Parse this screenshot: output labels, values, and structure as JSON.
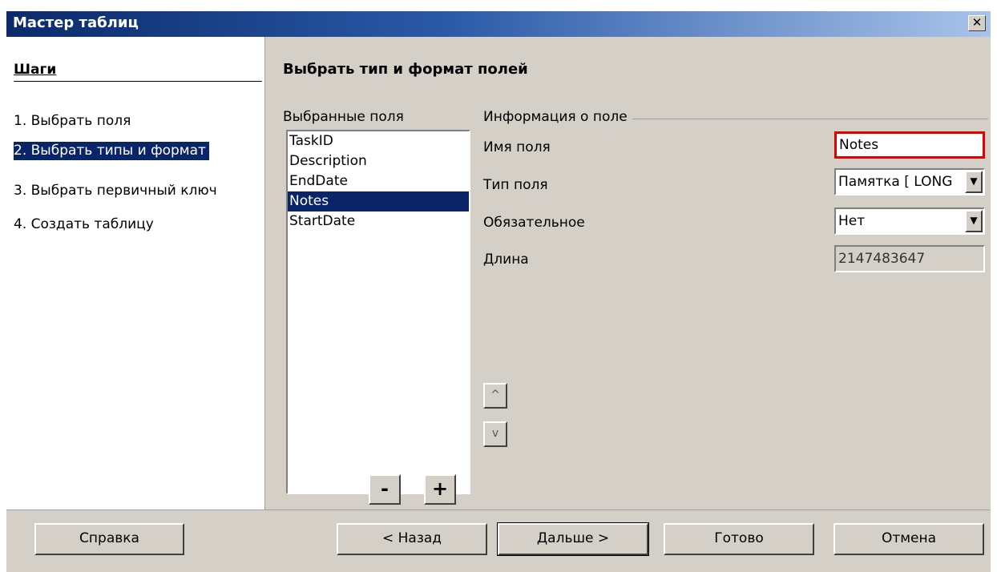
{
  "window": {
    "title": "Мастер таблиц",
    "close_glyph": "✕"
  },
  "steps": {
    "title": "Шаги",
    "items": [
      {
        "label": "1.  Выбрать поля",
        "selected": false
      },
      {
        "label": "2.  Выбрать типы и формат",
        "selected": true
      },
      {
        "label": "3.  Выбрать первичный ключ",
        "selected": false
      },
      {
        "label": "4.  Создать таблицу",
        "selected": false
      }
    ]
  },
  "main": {
    "section_title": "Выбрать тип и формат полей",
    "selected_fields_label": "Выбранные поля",
    "fields": [
      "TaskID",
      "Description",
      "EndDate",
      "Notes",
      "StartDate"
    ],
    "selected_field": "Notes",
    "remove_label": "-",
    "add_label": "+",
    "move_up_glyph": "^",
    "move_down_glyph": "v"
  },
  "info": {
    "legend": "Информация о поле",
    "name_label": "Имя поля",
    "name_value": "Notes",
    "type_label": "Тип поля",
    "type_value": "Памятка [ LONG",
    "required_label": "Обязательное",
    "required_value": "Нет",
    "length_label": "Длина",
    "length_value": "2147483647"
  },
  "buttons": {
    "help": "Справка",
    "back": "< Назад",
    "next": "Дальше >",
    "finish": "Готово",
    "cancel": "Отмена"
  },
  "colors": {
    "selection": "#0a246a",
    "dialog_bg": "#d4d0c8",
    "highlight_border": "#e00000"
  }
}
